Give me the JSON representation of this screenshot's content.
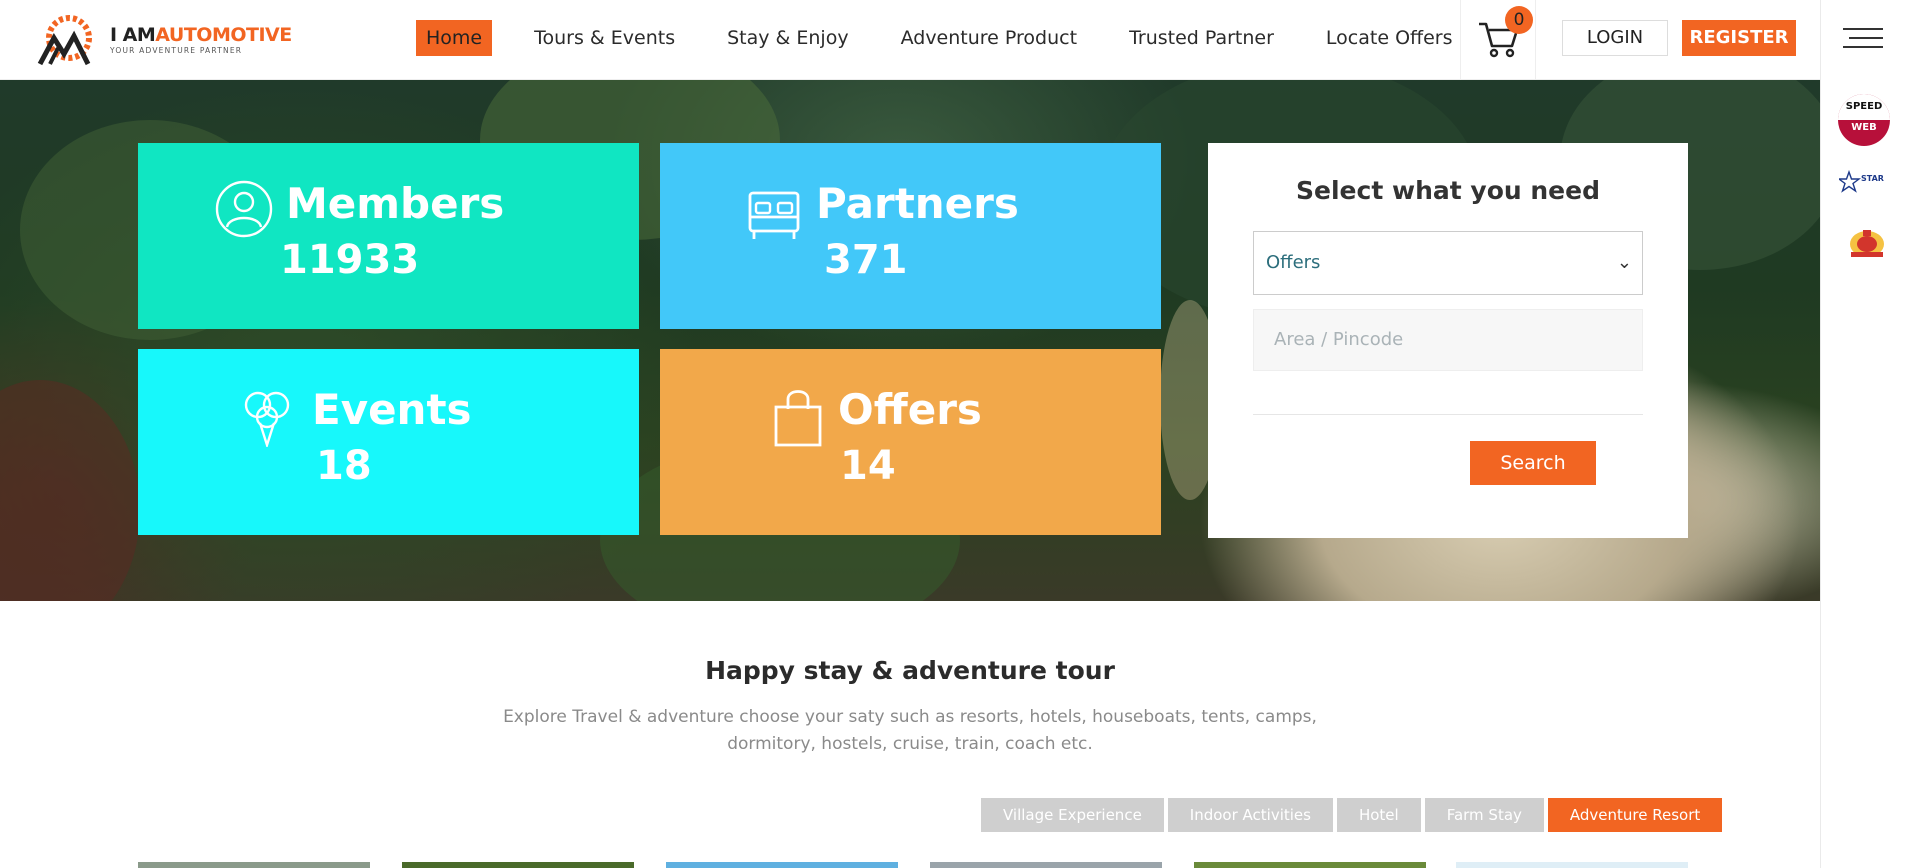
{
  "brand": {
    "name_part1": "I AM",
    "name_part2": "AUTOMOTIVE",
    "tagline": "YOUR ADVENTURE PARTNER",
    "accent_color": "#f26522"
  },
  "nav": {
    "items": [
      {
        "label": "Home",
        "active": true
      },
      {
        "label": "Tours & Events",
        "active": false
      },
      {
        "label": "Stay & Enjoy",
        "active": false
      },
      {
        "label": "Adventure Product",
        "active": false
      },
      {
        "label": "Trusted Partner",
        "active": false
      },
      {
        "label": "Locate Offers",
        "active": false
      }
    ]
  },
  "cart": {
    "count": "0",
    "icon": "cart-icon"
  },
  "auth": {
    "login_label": "LOGIN",
    "register_label": "REGISTER"
  },
  "sidebar": {
    "badge1_top": "SPEED",
    "badge1_bottom": "WEB",
    "badge2_text": "STAR",
    "menu_icon": "hamburger-icon"
  },
  "stats": {
    "members": {
      "label": "Members",
      "value": "11933",
      "icon": "user-icon",
      "color": "#10e6c2"
    },
    "partners": {
      "label": "Partners",
      "value": "371",
      "icon": "bed-icon",
      "color": "#42c8f9"
    },
    "events": {
      "label": "Events",
      "value": "18",
      "icon": "balloons-icon",
      "color": "#17f8fb"
    },
    "offers": {
      "label": "Offers",
      "value": "14",
      "icon": "shopping-bag-icon",
      "color": "#f2a84a"
    }
  },
  "search": {
    "title": "Select what you need",
    "selected_option": "Offers",
    "area_placeholder": "Area / Pincode",
    "button_label": "Search"
  },
  "section": {
    "title": "Happy stay & adventure tour",
    "description": "Explore Travel & adventure choose your saty such as resorts, hotels, houseboats, tents, camps, dormitory, hostels, cruise, train, coach etc."
  },
  "filters": [
    {
      "label": "Village Experience",
      "active": false
    },
    {
      "label": "Indoor Activities",
      "active": false
    },
    {
      "label": "Hotel",
      "active": false
    },
    {
      "label": "Farm Stay",
      "active": false
    },
    {
      "label": "Adventure Resort",
      "active": true
    }
  ]
}
